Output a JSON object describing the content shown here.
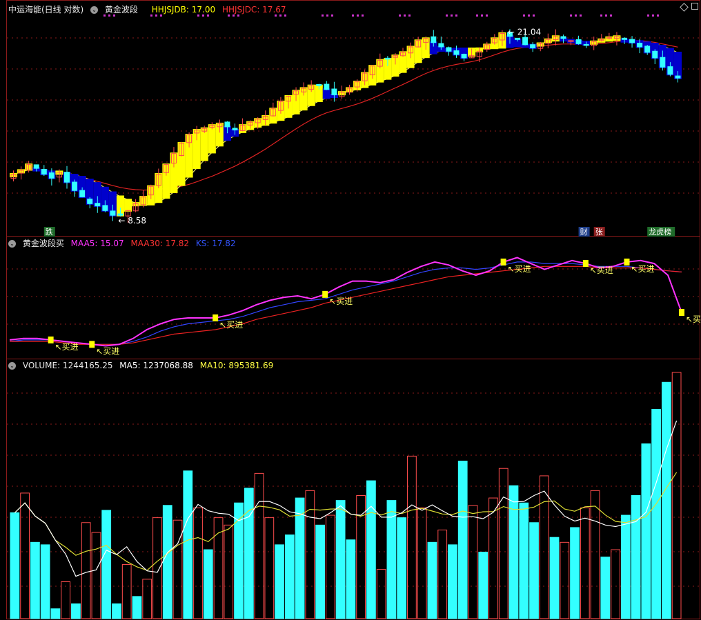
{
  "main_header": {
    "title": "中运海能(日线 对数)",
    "indicator": "黄金波段",
    "hhjsjdb": "HHJSJDB: 17.00",
    "hhjsjdc": "HHJSJDC: 17.67"
  },
  "buy_header": {
    "title": "黄金波段买",
    "maa5": "MAA5: 15.07",
    "maa30": "MAA30: 17.82",
    "ks": "KS: 17.82"
  },
  "volume_header": {
    "volume": "VOLUME: 1244165.25",
    "ma5": "MA5: 1237068.88",
    "ma10": "MA10: 895381.69"
  },
  "annotations": {
    "high_label": "21.04",
    "low_label": "8.58",
    "badge_die": "跌",
    "badge_cai": "财",
    "badge_zhang": "张",
    "badge_lhb": "龙虎榜",
    "buy_label": "买进"
  },
  "colors": {
    "up": "#ff4d4d",
    "down": "#33ffff",
    "band_up": "#ffff00",
    "band_down": "#0000cc",
    "maa5": "#ff33ff",
    "maa30": "#ee2222",
    "ks": "#3344ff",
    "ma5": "#ffffff",
    "ma10": "#dddd33",
    "grid": "#8b1a1a"
  },
  "chart_data": [
    {
      "type": "candlestick",
      "scale": "log",
      "ylim": [
        8.3,
        22.2
      ],
      "high": 21.04,
      "low": 8.58,
      "close": [
        10.7,
        10.9,
        11.2,
        11.0,
        10.7,
        10.5,
        10.8,
        10.3,
        9.9,
        9.6,
        9.3,
        9.2,
        9.0,
        8.8,
        8.8,
        9.0,
        9.3,
        9.6,
        10.1,
        10.7,
        11.2,
        11.8,
        12.4,
        12.9,
        13.2,
        13.3,
        13.5,
        13.6,
        13.4,
        13.2,
        13.5,
        13.7,
        13.9,
        14.1,
        14.6,
        15.1,
        15.5,
        15.9,
        16.1,
        16.3,
        16.3,
        16.0,
        15.6,
        15.8,
        16.1,
        16.6,
        17.3,
        17.9,
        18.4,
        18.5,
        18.8,
        19.1,
        19.6,
        20.2,
        20.4,
        20.0,
        19.6,
        19.2,
        18.9,
        18.6,
        18.8,
        19.2,
        19.8,
        20.4,
        20.9,
        20.6,
        20.3,
        19.8,
        19.5,
        19.9,
        20.3,
        20.6,
        20.4,
        20.2,
        19.9,
        19.8,
        20.1,
        20.3,
        20.5,
        20.6,
        20.3,
        20.0,
        19.6,
        19.1,
        18.6,
        17.8,
        17.2,
        16.9
      ],
      "indicator_series": [
        {
          "name": "HHJSJDB",
          "value": 17.0
        },
        {
          "name": "HHJSJDC",
          "value": 17.67
        }
      ]
    },
    {
      "type": "line",
      "series": [
        {
          "name": "MAA5",
          "values": [
            13.2,
            13.3,
            13.3,
            13.2,
            13.1,
            13.0,
            12.9,
            12.8,
            12.9,
            13.3,
            13.9,
            14.3,
            14.6,
            14.7,
            14.7,
            14.7,
            14.9,
            15.2,
            15.6,
            15.9,
            16.1,
            16.2,
            16.0,
            16.3,
            16.8,
            17.2,
            17.2,
            17.1,
            17.3,
            17.8,
            18.2,
            18.5,
            18.3,
            17.9,
            17.6,
            17.9,
            18.5,
            18.8,
            18.4,
            18.0,
            18.3,
            18.6,
            18.4,
            18.1,
            18.2,
            18.5,
            18.6,
            18.4,
            17.6,
            15.07
          ]
        },
        {
          "name": "MAA30",
          "values": [
            13.1,
            13.1,
            13.1,
            13.1,
            13.0,
            12.9,
            12.9,
            12.9,
            12.9,
            13.0,
            13.2,
            13.4,
            13.6,
            13.7,
            13.8,
            13.9,
            14.1,
            14.3,
            14.6,
            14.8,
            15.0,
            15.2,
            15.4,
            15.7,
            15.9,
            16.1,
            16.3,
            16.5,
            16.7,
            16.9,
            17.1,
            17.3,
            17.5,
            17.6,
            17.7,
            17.8,
            17.9,
            18.0,
            18.1,
            18.2,
            18.2,
            18.2,
            18.2,
            18.1,
            18.1,
            18.1,
            18.1,
            18.0,
            17.9,
            17.82
          ]
        },
        {
          "name": "KS",
          "values": [
            13.1,
            13.2,
            13.2,
            13.2,
            13.1,
            13.0,
            12.9,
            12.9,
            12.9,
            13.1,
            13.4,
            13.8,
            14.1,
            14.3,
            14.4,
            14.5,
            14.6,
            14.8,
            15.1,
            15.4,
            15.6,
            15.8,
            15.9,
            16.0,
            16.3,
            16.6,
            16.8,
            17.0,
            17.2,
            17.5,
            17.8,
            18.0,
            18.1,
            18.1,
            18.0,
            18.1,
            18.3,
            18.5,
            18.5,
            18.4,
            18.4,
            18.4,
            18.3,
            18.2,
            18.2,
            18.2,
            18.1,
            18.0,
            17.9,
            17.82
          ]
        }
      ],
      "buy_points": [
        3,
        6,
        15,
        23,
        36,
        42,
        45,
        49
      ]
    },
    {
      "type": "bar",
      "series": [
        {
          "name": "VOLUME",
          "values": [
            0.43,
            0.51,
            0.31,
            0.3,
            0.04,
            0.15,
            0.06,
            0.39,
            0.35,
            0.44,
            0.06,
            0.22,
            0.09,
            0.16,
            0.41,
            0.46,
            0.4,
            0.6,
            0.45,
            0.28,
            0.41,
            0.38,
            0.47,
            0.53,
            0.59,
            0.41,
            0.3,
            0.34,
            0.49,
            0.52,
            0.38,
            0.42,
            0.48,
            0.32,
            0.5,
            0.56,
            0.2,
            0.48,
            0.41,
            0.66,
            0.45,
            0.31,
            0.36,
            0.3,
            0.64,
            0.46,
            0.27,
            0.49,
            0.61,
            0.54,
            0.47,
            0.39,
            0.58,
            0.33,
            0.31,
            0.37,
            0.45,
            0.52,
            0.25,
            0.28,
            0.42,
            0.5,
            0.71,
            0.85,
            0.96,
            1.0
          ],
          "directions": "DUDDDUDUUDDUDUUDUDUDUUDDUUDDDUDUDDUDUDDUUDUDDUDUUDDDUDUDUUDUDDDDDU"
        },
        {
          "name": "MA5",
          "value": 1237068.88
        },
        {
          "name": "MA10",
          "value": 895381.69
        }
      ]
    }
  ]
}
